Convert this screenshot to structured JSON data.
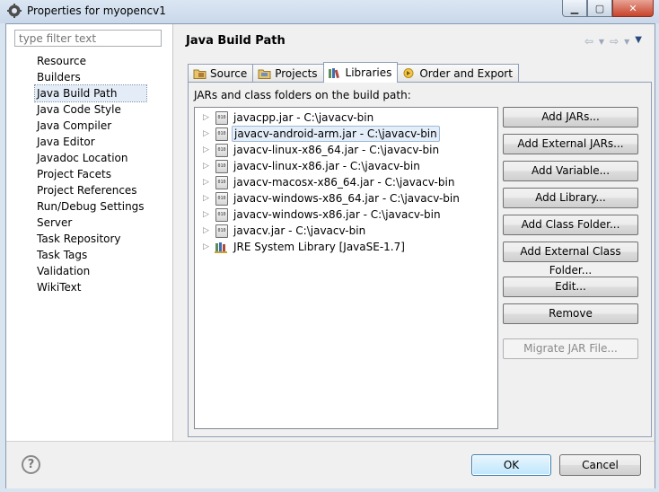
{
  "window": {
    "title": "Properties for myopencv1",
    "minimize_icon": "minimize-icon",
    "maximize_icon": "maximize-icon",
    "close_icon": "close-icon"
  },
  "filter": {
    "placeholder": "type filter text"
  },
  "nav": {
    "items": [
      "Resource",
      "Builders",
      "Java Build Path",
      "Java Code Style",
      "Java Compiler",
      "Java Editor",
      "Javadoc Location",
      "Project Facets",
      "Project References",
      "Run/Debug Settings",
      "Server",
      "Task Repository",
      "Task Tags",
      "Validation",
      "WikiText"
    ],
    "selected": "Java Build Path"
  },
  "page": {
    "title": "Java Build Path"
  },
  "tabs": [
    "Source",
    "Projects",
    "Libraries",
    "Order and Export"
  ],
  "active_tab": "Libraries",
  "libraries": {
    "label": "JARs and class folders on the build path:",
    "entries": [
      "javacpp.jar - C:\\javacv-bin",
      "javacv-android-arm.jar - C:\\javacv-bin",
      "javacv-linux-x86_64.jar - C:\\javacv-bin",
      "javacv-linux-x86.jar - C:\\javacv-bin",
      "javacv-macosx-x86_64.jar - C:\\javacv-bin",
      "javacv-windows-x86_64.jar - C:\\javacv-bin",
      "javacv-windows-x86.jar - C:\\javacv-bin",
      "javacv.jar - C:\\javacv-bin",
      "JRE System Library [JavaSE-1.7]"
    ],
    "selected_entry": "javacv-android-arm.jar - C:\\javacv-bin",
    "jar_icon_text": "010"
  },
  "buttons": {
    "add_jars": "Add JARs...",
    "add_external_jars": "Add External JARs...",
    "add_variable": "Add Variable...",
    "add_library": "Add Library...",
    "add_class_folder": "Add Class Folder...",
    "add_external_class_folder": "Add External Class Folder...",
    "edit": "Edit...",
    "remove": "Remove",
    "migrate_jar": "Migrate JAR File..."
  },
  "footer": {
    "help": "?",
    "ok": "OK",
    "cancel": "Cancel"
  }
}
